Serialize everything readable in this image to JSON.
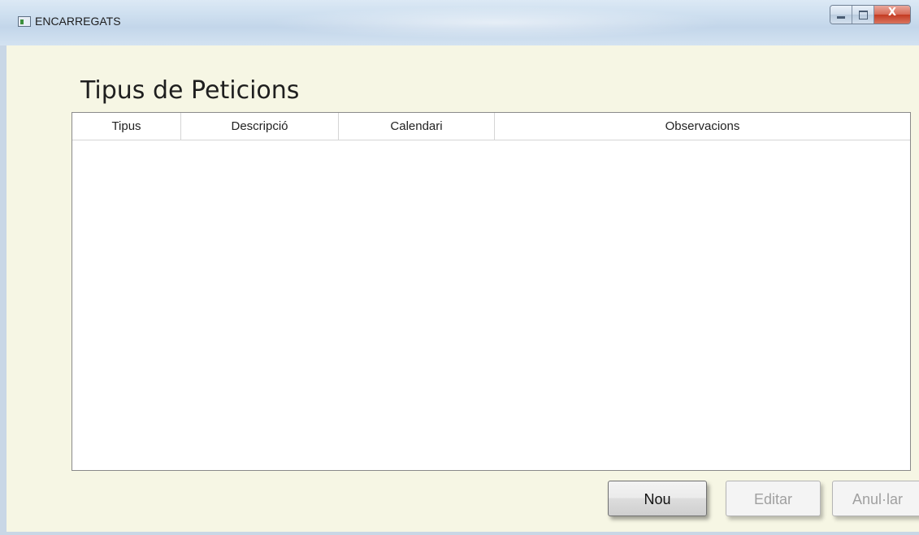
{
  "window": {
    "title": "ENCARREGATS",
    "minimize_icon": "minimize-icon",
    "maximize_icon": "maximize-icon",
    "close_icon": "close-icon",
    "close_glyph": "X"
  },
  "main": {
    "heading": "Tipus de Peticions",
    "table": {
      "columns": [
        "Tipus",
        "Descripció",
        "Calendari",
        "Observacions"
      ],
      "rows": []
    },
    "buttons": {
      "new_label": "Nou",
      "edit_label": "Editar",
      "cancel_label": "Anul·lar"
    }
  }
}
